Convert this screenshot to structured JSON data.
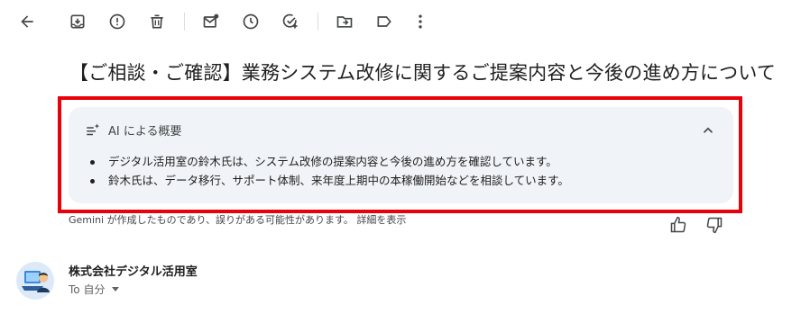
{
  "toolbar": {
    "buttons": [
      "back-icon",
      "archive-icon",
      "report-spam-icon",
      "delete-icon",
      "mark-unread-icon",
      "snooze-icon",
      "add-to-tasks-icon",
      "move-to-icon",
      "label-icon",
      "more-vert-icon"
    ]
  },
  "email": {
    "subject": "【ご相談・ご確認】業務システム改修に関するご提案内容と今後の進め方について"
  },
  "ai_summary": {
    "title": "AI による概要",
    "bullets": [
      "デジタル活用室の鈴木氏は、システム改修の提案内容と今後の進め方を確認しています。",
      "鈴木氏は、データ移行、サポート体制、来年度上期中の本稼働開始などを相談しています。"
    ],
    "disclaimer": "Gemini が作成したものであり、誤りがある可能性があります。",
    "details_link": "詳細を表示"
  },
  "sender": {
    "name": "株式会社デジタル活用室",
    "to_label": "To 自分"
  },
  "colors": {
    "highlight": "#e8000b",
    "card_bg": "#f0f3f7"
  }
}
